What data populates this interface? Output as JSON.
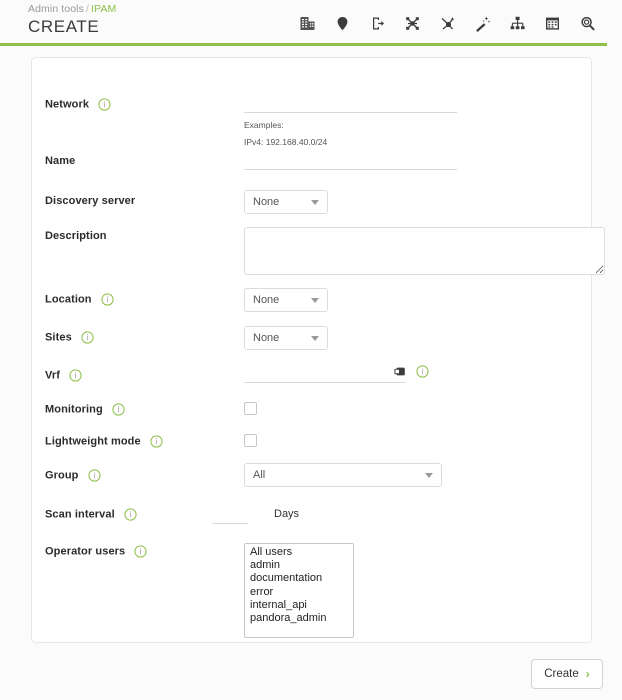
{
  "header": {
    "breadcrumb": {
      "parent": "Admin tools",
      "separator": "/",
      "current": "IPAM"
    },
    "title": "CREATE",
    "actions": [
      {
        "name": "networks-icon",
        "tooltip": "Networks"
      },
      {
        "name": "location-pin-icon",
        "tooltip": "Locations"
      },
      {
        "name": "export-icon",
        "tooltip": "Export"
      },
      {
        "name": "network-map-icon",
        "tooltip": "Network map"
      },
      {
        "name": "traceroute-icon",
        "tooltip": "Traceroute"
      },
      {
        "name": "magic-wand-icon",
        "tooltip": "Wizard"
      },
      {
        "name": "sitemap-icon",
        "tooltip": "Sitemap"
      },
      {
        "name": "calendar-icon",
        "tooltip": "Calendar"
      },
      {
        "name": "search-icon",
        "tooltip": "Search"
      }
    ],
    "accent_color": "#8ec04a"
  },
  "form": {
    "network": {
      "label": "Network",
      "value": "",
      "helper_title": "Examples:",
      "helper_example": "IPv4: 192.168.40.0/24"
    },
    "name": {
      "label": "Name",
      "value": ""
    },
    "discovery_server": {
      "label": "Discovery server",
      "value": "None"
    },
    "description": {
      "label": "Description",
      "value": ""
    },
    "location": {
      "label": "Location",
      "value": "None"
    },
    "sites": {
      "label": "Sites",
      "value": "None"
    },
    "vrf": {
      "label": "Vrf",
      "value": ""
    },
    "monitoring": {
      "label": "Monitoring",
      "checked": false
    },
    "lightweight_mode": {
      "label": "Lightweight mode",
      "checked": false
    },
    "group": {
      "label": "Group",
      "value": "All"
    },
    "scan_interval": {
      "label": "Scan interval",
      "value": "",
      "unit": "Days"
    },
    "operator_users": {
      "label": "Operator users",
      "options": [
        "All users",
        "admin",
        "documentation",
        "error",
        "internal_api",
        "pandora_admin"
      ]
    }
  },
  "footer": {
    "create_label": "Create",
    "create_chevron": "›"
  }
}
